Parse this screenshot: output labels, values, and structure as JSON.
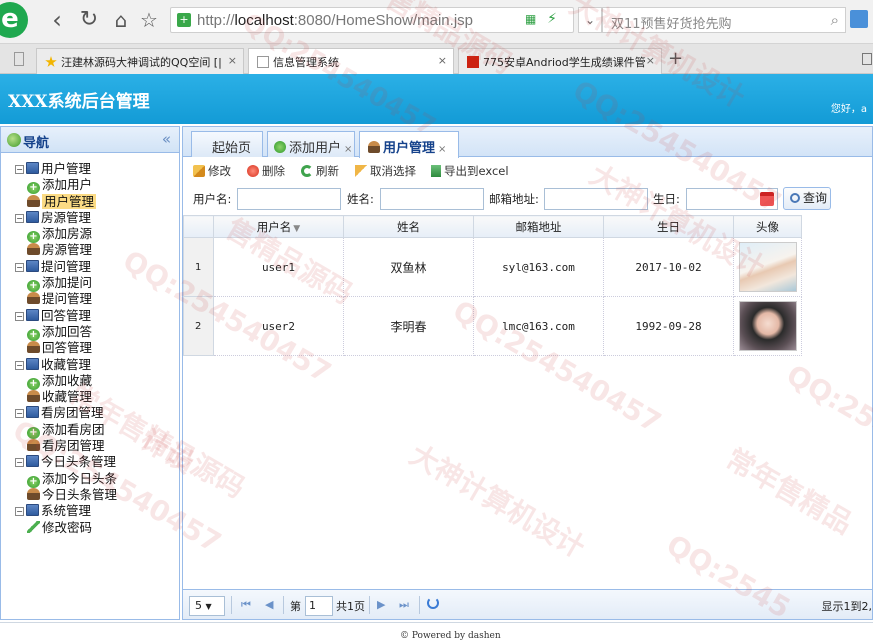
{
  "browser": {
    "url_prefix": "http://",
    "url_host": "localhost",
    "url_rest": ":8080/HomeShow/main.jsp",
    "search_placeholder": "双11预售好货抢先购",
    "tabs": [
      {
        "label": "汪建林源码大神调试的QQ空间 [|",
        "fav_color": "#f2b500"
      },
      {
        "label": "信息管理系统",
        "fav_color": "#999999",
        "active": true
      },
      {
        "label": "775安卓Andriod学生成绩课件管",
        "fav_color": "#cc2211"
      }
    ],
    "close_glyph": "×",
    "new_tab_glyph": "+"
  },
  "header": {
    "title": "XXX系统后台管理",
    "welcome": "您好，a"
  },
  "nav": {
    "title": "导航",
    "collapse_glyph": "«",
    "groups": [
      {
        "label": "用户管理",
        "children": [
          {
            "label": "添加用户",
            "icon": "add-icon"
          },
          {
            "label": "用户管理",
            "icon": "user-icon",
            "selected": true
          }
        ]
      },
      {
        "label": "房源管理",
        "children": [
          {
            "label": "添加房源",
            "icon": "add-icon"
          },
          {
            "label": "房源管理",
            "icon": "user-icon"
          }
        ]
      },
      {
        "label": "提问管理",
        "children": [
          {
            "label": "添加提问",
            "icon": "add-icon"
          },
          {
            "label": "提问管理",
            "icon": "user-icon"
          }
        ]
      },
      {
        "label": "回答管理",
        "children": [
          {
            "label": "添加回答",
            "icon": "add-icon"
          },
          {
            "label": "回答管理",
            "icon": "user-icon"
          }
        ]
      },
      {
        "label": "收藏管理",
        "children": [
          {
            "label": "添加收藏",
            "icon": "add-icon"
          },
          {
            "label": "收藏管理",
            "icon": "user-icon"
          }
        ]
      },
      {
        "label": "看房团管理",
        "children": [
          {
            "label": "添加看房团",
            "icon": "add-icon"
          },
          {
            "label": "看房团管理",
            "icon": "user-icon"
          }
        ]
      },
      {
        "label": "今日头条管理",
        "children": [
          {
            "label": "添加今日头条",
            "icon": "add-icon"
          },
          {
            "label": "今日头条管理",
            "icon": "user-icon"
          }
        ]
      },
      {
        "label": "系统管理",
        "children": [
          {
            "label": "修改密码",
            "icon": "pencil-icon"
          }
        ]
      }
    ]
  },
  "main_tabs": {
    "home": "起始页",
    "add_user": "添加用户",
    "user_manage": "用户管理",
    "close_glyph": "×"
  },
  "toolbar": {
    "edit": "修改",
    "delete": "删除",
    "refresh": "刷新",
    "cancel_select": "取消选择",
    "export": "导出到excel"
  },
  "filter": {
    "username_label": "用户名:",
    "name_label": "姓名:",
    "email_label": "邮箱地址:",
    "birthday_label": "生日:",
    "query_button": "查询"
  },
  "grid": {
    "sort_glyph": "▼",
    "columns": [
      "用户名",
      "姓名",
      "邮箱地址",
      "生日",
      "头像"
    ],
    "rows": [
      {
        "index": "1",
        "username": "user1",
        "name": "双鱼林",
        "email": "syl@163.com",
        "birthday": "2017-10-02"
      },
      {
        "index": "2",
        "username": "user2",
        "name": "李明春",
        "email": "lmc@163.com",
        "birthday": "1992-09-28"
      }
    ]
  },
  "pager": {
    "page_size": "5",
    "page_size_arrow": "▼",
    "first": "⏮",
    "prev": "◀",
    "next": "▶",
    "last": "⏭",
    "page_prefix": "第",
    "page_value": "1",
    "page_suffix": "共1页",
    "info": "显示1到2,"
  },
  "footer": {
    "text": "© Powered by dashen"
  },
  "watermarks": [
    "QQ:254540457",
    "大神计算机设计",
    "常年售精品源码",
    "售精品源码",
    "QQ:2545",
    "常年售精品",
    "计设"
  ]
}
